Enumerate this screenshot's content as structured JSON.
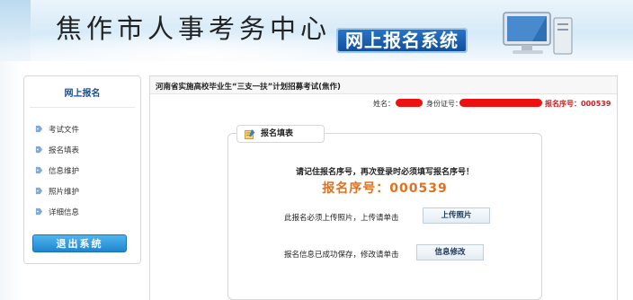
{
  "header": {
    "site_title": "焦作市人事考务中心",
    "system_badge": "网上报名系统"
  },
  "sidebar": {
    "title": "网上报名",
    "items": [
      {
        "label": "考试文件",
        "icon": "tag-icon"
      },
      {
        "label": "报名填表",
        "icon": "tag-icon"
      },
      {
        "label": "信息维护",
        "icon": "tag-icon"
      },
      {
        "label": "照片维护",
        "icon": "tag-icon"
      },
      {
        "label": "详细信息",
        "icon": "tag-icon"
      }
    ],
    "logout_label": "退出系统"
  },
  "main": {
    "title": "河南省实施高校毕业生“三支一扶”计划招募考试(焦作)",
    "name_label": "姓名：",
    "id_label": "身份证号：",
    "reg_no_top": "报名序号：000539",
    "form_tab": "报名填表",
    "notice": "请记住报名序号，再次登录时必须填写报名序号！",
    "reg_no_big": "报名序号：000539",
    "photo_text": "此报名必须上传照片，上传请单击",
    "photo_button": "上传照片",
    "edit_text": "报名信息已成功保存，修改请单击",
    "edit_button": "信息修改"
  },
  "colors": {
    "accent_blue": "#1e86cf",
    "redaction": "#ee1111",
    "reg_no_orange": "#e2701c"
  }
}
